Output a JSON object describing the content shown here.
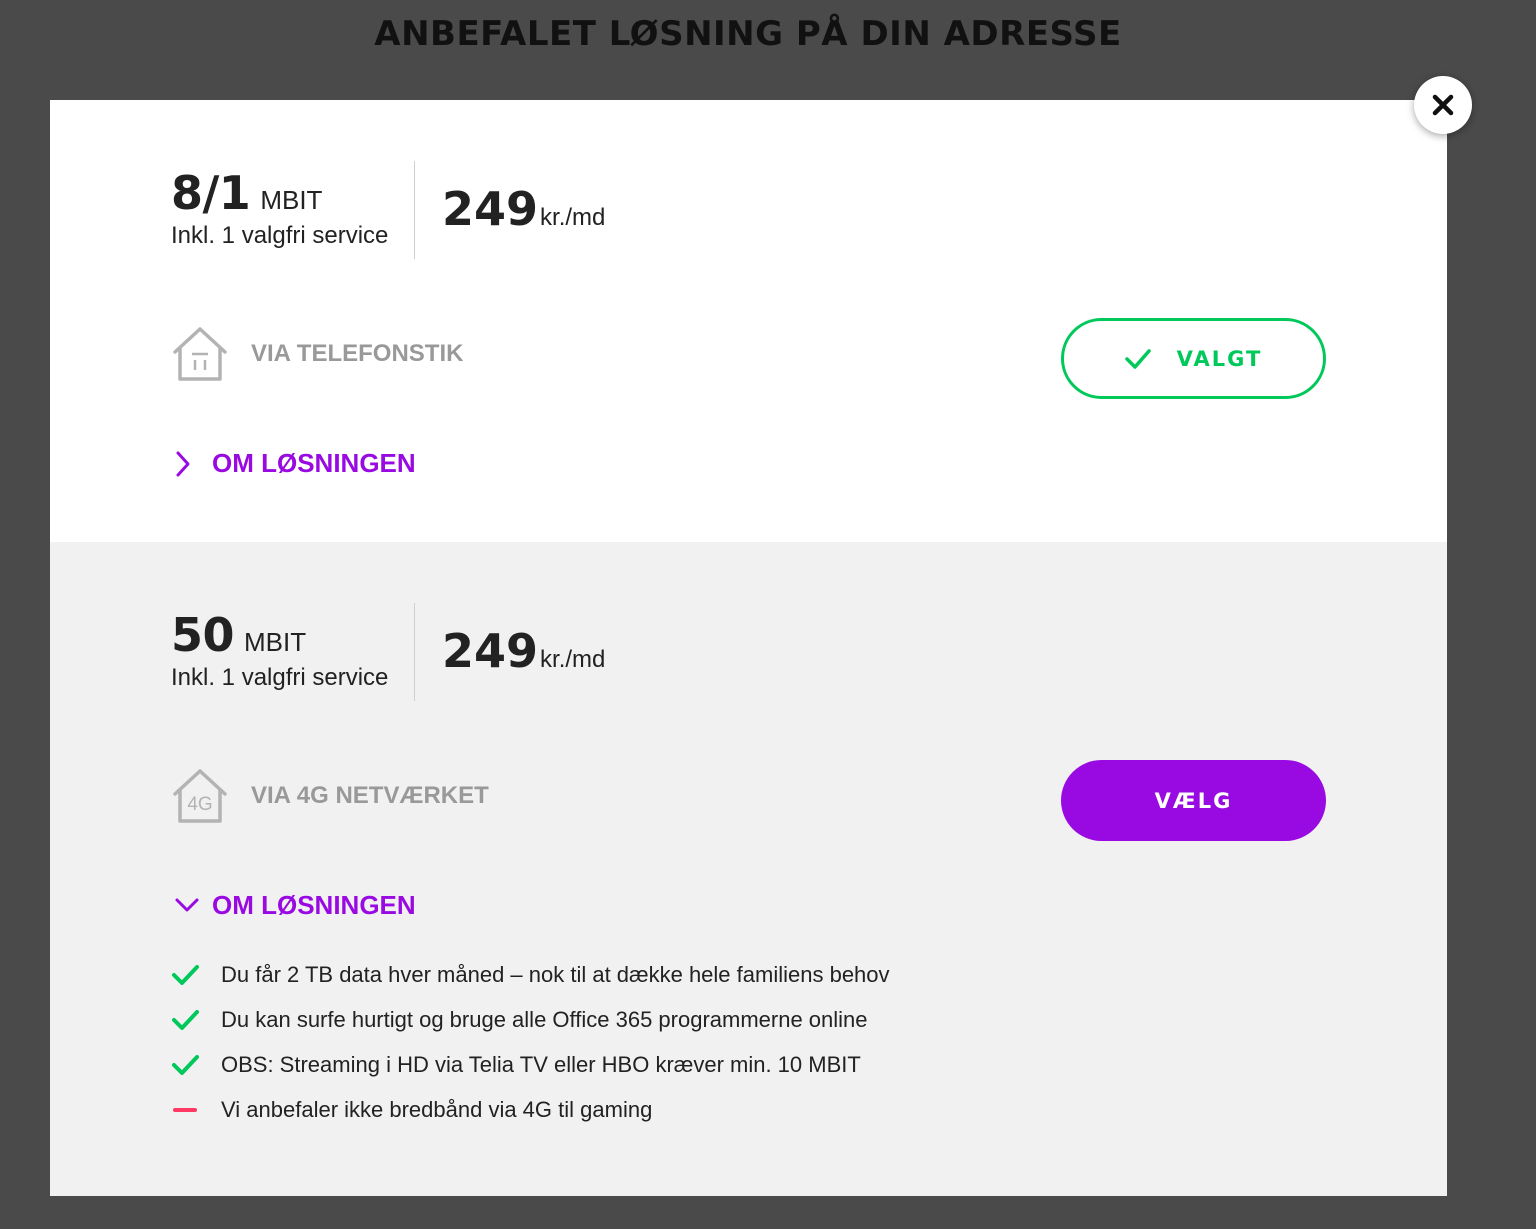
{
  "heading": "ANBEFALET LØSNING PÅ DIN ADRESSE",
  "colors": {
    "accent_purple": "#990ae3",
    "selected_green": "#00c85a",
    "negative_pink": "#ff3964",
    "overlay": "#4a4a4a"
  },
  "close_icon": "close-icon",
  "solutions": [
    {
      "speed": "8/1",
      "speed_unit": "MBIT",
      "service_note": "Inkl. 1 valgfri service",
      "price": "249",
      "price_unit": "kr./md",
      "connection_icon": "house-phone-icon",
      "connection_label": "VIA TELEFONSTIK",
      "button_label": "VALGT",
      "button_state": "selected",
      "about_label": "OM LØSNINGEN",
      "about_expanded": false
    },
    {
      "speed": "50",
      "speed_unit": "MBIT",
      "service_note": "Inkl. 1 valgfri service",
      "price": "249",
      "price_unit": "kr./md",
      "connection_icon": "house-4g-icon",
      "connection_icon_text": "4G",
      "connection_label": "VIA 4G NETVÆRKET",
      "button_label": "VÆLG",
      "button_state": "default",
      "about_label": "OM LØSNINGEN",
      "about_expanded": true,
      "features": [
        {
          "type": "positive",
          "icon": "check-icon",
          "text": "Du får 2 TB data hver måned – nok til at dække hele familiens behov"
        },
        {
          "type": "positive",
          "icon": "check-icon",
          "text": "Du kan surfe hurtigt og bruge alle Office 365 programmerne online"
        },
        {
          "type": "positive",
          "icon": "check-icon",
          "text": "OBS: Streaming i HD via Telia TV eller HBO kræver min. 10 MBIT"
        },
        {
          "type": "negative",
          "icon": "minus-icon",
          "text": "Vi anbefaler ikke bredbånd via 4G til gaming"
        }
      ]
    }
  ]
}
